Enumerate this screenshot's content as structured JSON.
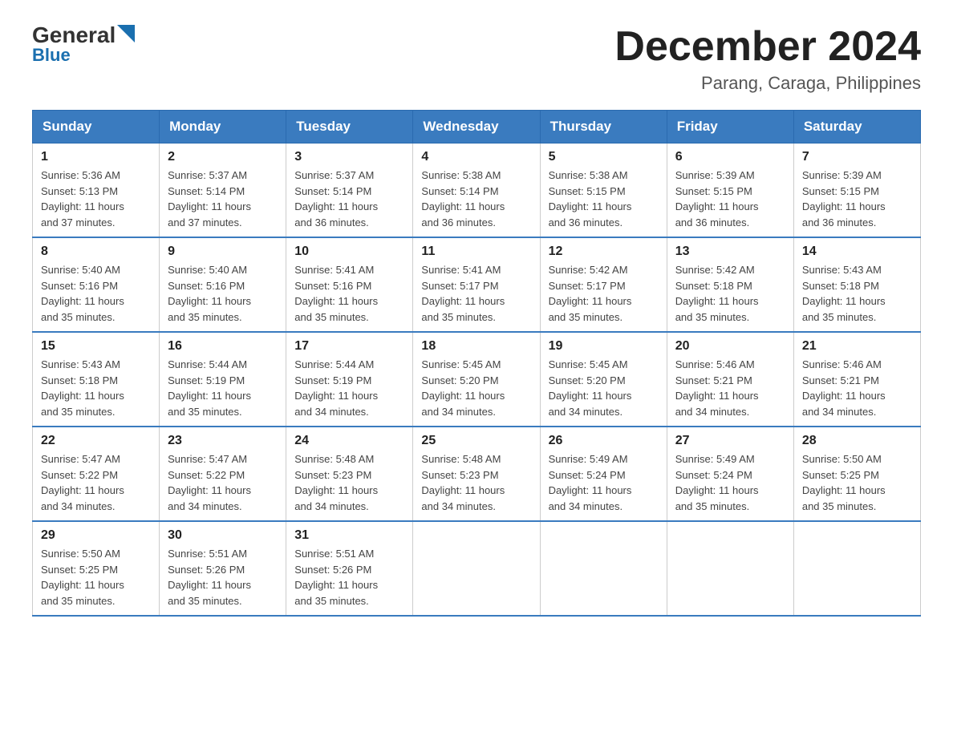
{
  "header": {
    "logo_general": "General",
    "logo_blue": "Blue",
    "month_year": "December 2024",
    "location": "Parang, Caraga, Philippines"
  },
  "weekdays": [
    "Sunday",
    "Monday",
    "Tuesday",
    "Wednesday",
    "Thursday",
    "Friday",
    "Saturday"
  ],
  "weeks": [
    [
      {
        "day": "1",
        "sunrise": "5:36 AM",
        "sunset": "5:13 PM",
        "daylight": "11 hours and 37 minutes."
      },
      {
        "day": "2",
        "sunrise": "5:37 AM",
        "sunset": "5:14 PM",
        "daylight": "11 hours and 37 minutes."
      },
      {
        "day": "3",
        "sunrise": "5:37 AM",
        "sunset": "5:14 PM",
        "daylight": "11 hours and 36 minutes."
      },
      {
        "day": "4",
        "sunrise": "5:38 AM",
        "sunset": "5:14 PM",
        "daylight": "11 hours and 36 minutes."
      },
      {
        "day": "5",
        "sunrise": "5:38 AM",
        "sunset": "5:15 PM",
        "daylight": "11 hours and 36 minutes."
      },
      {
        "day": "6",
        "sunrise": "5:39 AM",
        "sunset": "5:15 PM",
        "daylight": "11 hours and 36 minutes."
      },
      {
        "day": "7",
        "sunrise": "5:39 AM",
        "sunset": "5:15 PM",
        "daylight": "11 hours and 36 minutes."
      }
    ],
    [
      {
        "day": "8",
        "sunrise": "5:40 AM",
        "sunset": "5:16 PM",
        "daylight": "11 hours and 35 minutes."
      },
      {
        "day": "9",
        "sunrise": "5:40 AM",
        "sunset": "5:16 PM",
        "daylight": "11 hours and 35 minutes."
      },
      {
        "day": "10",
        "sunrise": "5:41 AM",
        "sunset": "5:16 PM",
        "daylight": "11 hours and 35 minutes."
      },
      {
        "day": "11",
        "sunrise": "5:41 AM",
        "sunset": "5:17 PM",
        "daylight": "11 hours and 35 minutes."
      },
      {
        "day": "12",
        "sunrise": "5:42 AM",
        "sunset": "5:17 PM",
        "daylight": "11 hours and 35 minutes."
      },
      {
        "day": "13",
        "sunrise": "5:42 AM",
        "sunset": "5:18 PM",
        "daylight": "11 hours and 35 minutes."
      },
      {
        "day": "14",
        "sunrise": "5:43 AM",
        "sunset": "5:18 PM",
        "daylight": "11 hours and 35 minutes."
      }
    ],
    [
      {
        "day": "15",
        "sunrise": "5:43 AM",
        "sunset": "5:18 PM",
        "daylight": "11 hours and 35 minutes."
      },
      {
        "day": "16",
        "sunrise": "5:44 AM",
        "sunset": "5:19 PM",
        "daylight": "11 hours and 35 minutes."
      },
      {
        "day": "17",
        "sunrise": "5:44 AM",
        "sunset": "5:19 PM",
        "daylight": "11 hours and 34 minutes."
      },
      {
        "day": "18",
        "sunrise": "5:45 AM",
        "sunset": "5:20 PM",
        "daylight": "11 hours and 34 minutes."
      },
      {
        "day": "19",
        "sunrise": "5:45 AM",
        "sunset": "5:20 PM",
        "daylight": "11 hours and 34 minutes."
      },
      {
        "day": "20",
        "sunrise": "5:46 AM",
        "sunset": "5:21 PM",
        "daylight": "11 hours and 34 minutes."
      },
      {
        "day": "21",
        "sunrise": "5:46 AM",
        "sunset": "5:21 PM",
        "daylight": "11 hours and 34 minutes."
      }
    ],
    [
      {
        "day": "22",
        "sunrise": "5:47 AM",
        "sunset": "5:22 PM",
        "daylight": "11 hours and 34 minutes."
      },
      {
        "day": "23",
        "sunrise": "5:47 AM",
        "sunset": "5:22 PM",
        "daylight": "11 hours and 34 minutes."
      },
      {
        "day": "24",
        "sunrise": "5:48 AM",
        "sunset": "5:23 PM",
        "daylight": "11 hours and 34 minutes."
      },
      {
        "day": "25",
        "sunrise": "5:48 AM",
        "sunset": "5:23 PM",
        "daylight": "11 hours and 34 minutes."
      },
      {
        "day": "26",
        "sunrise": "5:49 AM",
        "sunset": "5:24 PM",
        "daylight": "11 hours and 34 minutes."
      },
      {
        "day": "27",
        "sunrise": "5:49 AM",
        "sunset": "5:24 PM",
        "daylight": "11 hours and 35 minutes."
      },
      {
        "day": "28",
        "sunrise": "5:50 AM",
        "sunset": "5:25 PM",
        "daylight": "11 hours and 35 minutes."
      }
    ],
    [
      {
        "day": "29",
        "sunrise": "5:50 AM",
        "sunset": "5:25 PM",
        "daylight": "11 hours and 35 minutes."
      },
      {
        "day": "30",
        "sunrise": "5:51 AM",
        "sunset": "5:26 PM",
        "daylight": "11 hours and 35 minutes."
      },
      {
        "day": "31",
        "sunrise": "5:51 AM",
        "sunset": "5:26 PM",
        "daylight": "11 hours and 35 minutes."
      },
      null,
      null,
      null,
      null
    ]
  ],
  "labels": {
    "sunrise": "Sunrise:",
    "sunset": "Sunset:",
    "daylight": "Daylight:"
  }
}
